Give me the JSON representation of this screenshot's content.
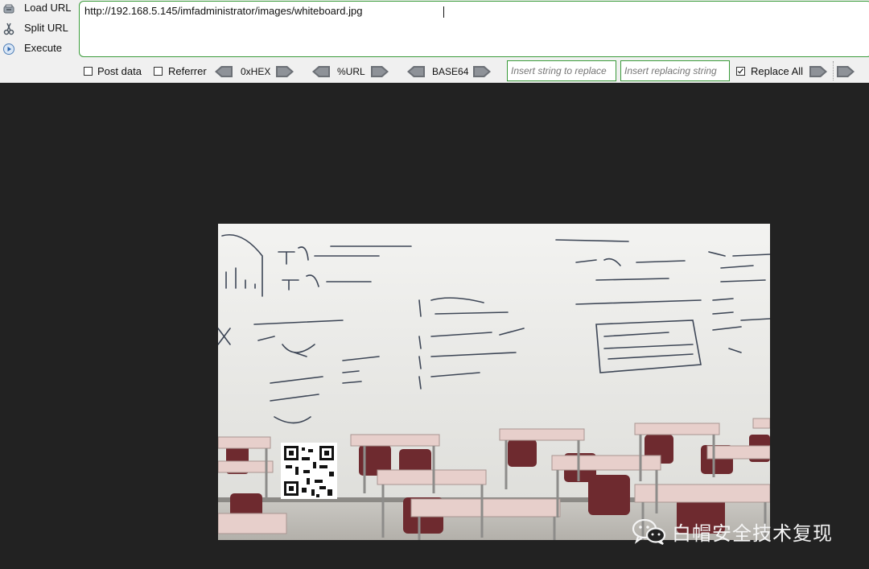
{
  "hackbar": {
    "side_buttons": [
      {
        "label": "Load URL"
      },
      {
        "label": "Split URL"
      },
      {
        "label": "Execute"
      }
    ],
    "url_value": "http://192.168.5.145/imfadministrator/images/whiteboard.jpg",
    "options": {
      "post_data": {
        "label": "Post data",
        "checked": false
      },
      "referrer": {
        "label": "Referrer",
        "checked": false
      },
      "replace_all": {
        "label": "Replace All",
        "checked": true
      }
    },
    "encoders": [
      {
        "label": "0xHEX"
      },
      {
        "label": "%URL"
      },
      {
        "label": "BASE64"
      }
    ],
    "replace_placeholder": "Insert string to replace",
    "replacing_placeholder": "Insert replacing string"
  },
  "watermark": {
    "text": "白帽安全技术复现"
  },
  "colors": {
    "accent_green": "#3a9b3a",
    "background": "#222222",
    "toolbar": "#f0f0f0"
  }
}
